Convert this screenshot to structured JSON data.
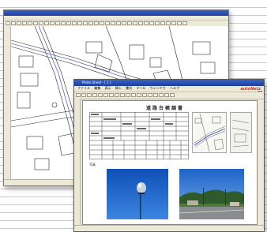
{
  "cad_window": {
    "title": "",
    "menu": [
      "",
      "",
      "",
      "",
      "",
      "",
      ""
    ],
    "status": ""
  },
  "report_window": {
    "title": "Photo Sheet - [ 1 ]",
    "menu": [
      "ファイル",
      "編集",
      "表示",
      "挿入",
      "書式",
      "ツール",
      "ウィンドウ",
      "ヘルプ"
    ],
    "brand": "autoNetz",
    "sheet_title": "道路台帳調書",
    "photo_label": "写真",
    "status": ""
  },
  "colors": {
    "titlebar": "#1c3fa0",
    "chrome": "#ece9d8",
    "sky": "#1f5fc7"
  }
}
